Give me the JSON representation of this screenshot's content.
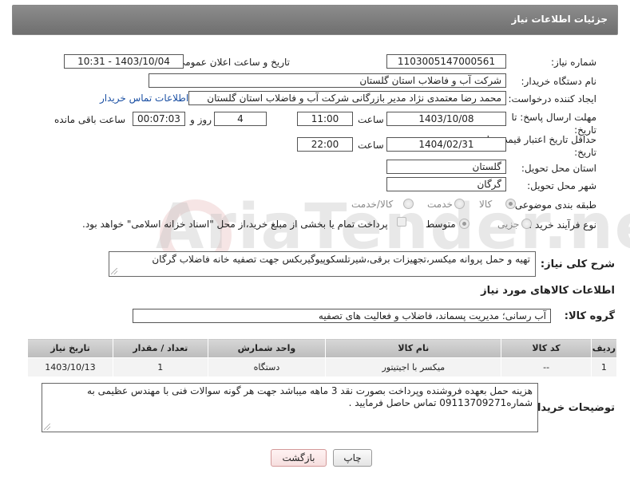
{
  "header": {
    "title": "جزئیات اطلاعات نیاز"
  },
  "form": {
    "need_number": {
      "label": "شماره نیاز:",
      "value": "1103005147000561"
    },
    "announce_datetime": {
      "label": "تاریخ و ساعت اعلان عمومی:",
      "value": "1403/10/04 - 10:31"
    },
    "buyer_org": {
      "label": "نام دستگاه خریدار:",
      "value": "شرکت آب و فاضلاب استان گلستان"
    },
    "requester": {
      "label": "ایجاد کننده درخواست:",
      "value": "محمد رضا معتمدی نژاد مدیر بازرگانی شرکت آب و فاضلاب استان گلستان",
      "contact_link": "اطلاعات تماس خریدار"
    },
    "reply_deadline": {
      "label": "مهلت ارسال پاسخ: تا تاریخ:",
      "date": "1403/10/08",
      "time_label": "ساعت",
      "time": "11:00",
      "days": "4",
      "days_label": "روز و",
      "remaining": "00:07:03",
      "remaining_label": "ساعت باقی مانده"
    },
    "price_validity": {
      "label": "حداقل تاریخ اعتبار قیمت: تا تاریخ:",
      "date": "1404/02/31",
      "time_label": "ساعت",
      "time": "22:00"
    },
    "province": {
      "label": "استان محل تحویل:",
      "value": "گلستان"
    },
    "city": {
      "label": "شهر محل تحویل:",
      "value": "گرگان"
    },
    "category": {
      "label": "طبقه بندی موضوعی:",
      "options": [
        "کالا",
        "خدمت",
        "کالا/خدمت"
      ]
    },
    "purchase_type": {
      "label": "نوع فرآیند خرید :",
      "options": [
        "جزیی",
        "متوسط"
      ],
      "note": "پرداخت تمام یا بخشی از مبلغ خرید،از محل \"اسناد خزانه اسلامی\" خواهد بود."
    },
    "description": {
      "label": "شرح کلی نیاز:",
      "value": "تهیه و حمل پروانه میکسر،تجهیزات برقی،شیرتلسکوپیوگیربکس جهت تصفیه خانه فاضلاب گرگان"
    }
  },
  "goods_section": {
    "title": "اطلاعات کالاهای مورد نیاز",
    "group_label": "گروه کالا:",
    "group_value": "آب رسانی؛ مدیریت پسماند، فاضلاب و فعالیت های تصفیه"
  },
  "table": {
    "headers": [
      "ردیف",
      "کد کالا",
      "نام کالا",
      "واحد شمارش",
      "تعداد / مقدار",
      "تاریخ نیاز"
    ],
    "rows": [
      [
        "1",
        "--",
        "میکسر با اجیتیتور",
        "دستگاه",
        "1",
        "1403/10/13"
      ]
    ]
  },
  "buyer_notes": {
    "label": "توضیحات خریدار:",
    "line1": "هزینه حمل بعهده فروشنده وپرداخت بصورت نقد 3 ماهه میباشد جهت هر گونه سوالات فنی با مهندس عظیمی به",
    "line2": "شماره09113709271 تماس حاصل فرمایید ."
  },
  "buttons": {
    "print": "چاپ",
    "back": "بازگشت"
  },
  "watermark": "AriaTender.neT"
}
